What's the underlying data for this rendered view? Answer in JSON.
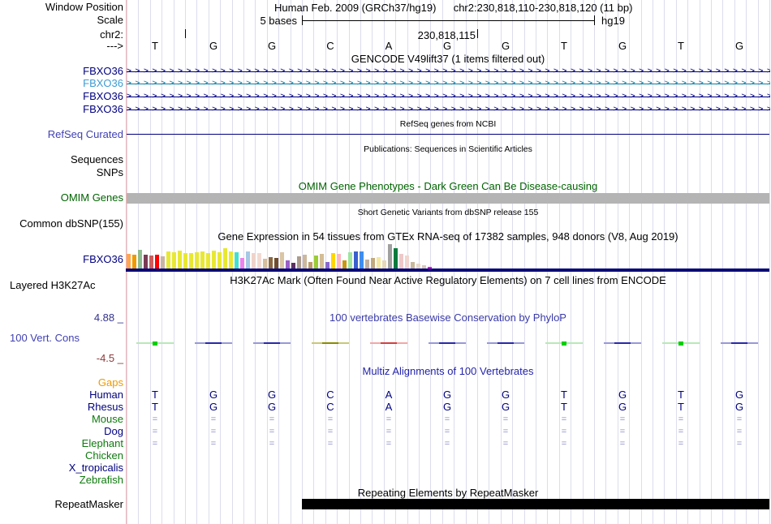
{
  "header": {
    "window_position_label": "Window Position",
    "assembly_title": "Human Feb. 2009 (GRCh37/hg19)",
    "range_title": "chr2:230,818,110-230,818,120 (11 bp)",
    "scale_label": "Scale",
    "scale_value": "5 bases",
    "assembly_tag": "hg19",
    "chrom_label": "chr2:",
    "coordinate_label": "230,818,115",
    "strand_label": "--->"
  },
  "sequence": {
    "bases": [
      "T",
      "G",
      "G",
      "C",
      "A",
      "G",
      "G",
      "T",
      "G",
      "T",
      "G"
    ]
  },
  "gencode": {
    "title": "GENCODE V49lift37 (1 items filtered out)",
    "genes": [
      {
        "label": "FBXO36",
        "label_color": "#000080",
        "line_color": "#000080"
      },
      {
        "label": "FBXO36",
        "label_color": "#3E9BD3",
        "line_color": "#0F7FA5"
      },
      {
        "label": "FBXO36",
        "label_color": "#000080",
        "line_color": "#000080"
      },
      {
        "label": "FBXO36",
        "label_color": "#000080",
        "line_color": "#000080"
      }
    ],
    "arrow_char": ">"
  },
  "refseq": {
    "title": "RefSeq genes from NCBI",
    "label": "RefSeq Curated",
    "label_color": "#4040B4",
    "line_color": "#000080"
  },
  "publications": {
    "title": "Publications: Sequences in Scientific Articles",
    "sequences_label": "Sequences",
    "snps_label": "SNPs"
  },
  "omim": {
    "title": "OMIM Gene Phenotypes - Dark Green Can Be Disease-causing",
    "label": "OMIM Genes",
    "color": "#006400",
    "bar_color": "#B4B4B4"
  },
  "dbsnp": {
    "title": "Short Genetic Variants from dbSNP release 155",
    "label": "Common dbSNP(155)"
  },
  "gtex": {
    "title": "Gene Expression in 54 tissues from GTEx RNA-seq of 17382 samples, 948 donors (V8, Aug 2019)",
    "label": "FBXO36",
    "label_color": "#000080",
    "baseline_color": "#0A0A78",
    "bars": [
      [
        "#FFA54F",
        18
      ],
      [
        "#EE9A00",
        17
      ],
      [
        "#8FBC8F",
        23
      ],
      [
        "#7A3A55",
        17
      ],
      [
        "#CD5C5C",
        16
      ],
      [
        "#FF0000",
        17
      ],
      [
        "#CBB3A3",
        15
      ],
      [
        "#E8E833",
        21
      ],
      [
        "#E8E833",
        20
      ],
      [
        "#E8E833",
        22
      ],
      [
        "#E8E833",
        19
      ],
      [
        "#E8E833",
        19
      ],
      [
        "#E8E833",
        20
      ],
      [
        "#E8E833",
        21
      ],
      [
        "#E8E833",
        19
      ],
      [
        "#E8E833",
        22
      ],
      [
        "#E8E833",
        20
      ],
      [
        "#E8E833",
        25
      ],
      [
        "#E8E833",
        21
      ],
      [
        "#40E0D0",
        20
      ],
      [
        "#EE82EE",
        13
      ],
      [
        "#A6C8E4",
        21
      ],
      [
        "#EFD3CA",
        19
      ],
      [
        "#F2DAD2",
        19
      ],
      [
        "#D6BE9C",
        12
      ],
      [
        "#8B6841",
        14
      ],
      [
        "#6E4C2D",
        13
      ],
      [
        "#DAC5A5",
        20
      ],
      [
        "#9A5FC8",
        10
      ],
      [
        "#5C3063",
        7
      ],
      [
        "#AB9C8E",
        15
      ],
      [
        "#CDB79B",
        17
      ],
      [
        "#BC9A68",
        8
      ],
      [
        "#9ACD32",
        16
      ],
      [
        "#D4BC96",
        18
      ],
      [
        "#8968CD",
        8
      ],
      [
        "#FFD700",
        19
      ],
      [
        "#FFB6C1",
        18
      ],
      [
        "#C79810",
        10
      ],
      [
        "#9FE49F",
        20
      ],
      [
        "#3A5FCD",
        21
      ],
      [
        "#3E8EF0",
        21
      ],
      [
        "#BFAF9F",
        11
      ],
      [
        "#C3A97E",
        13
      ],
      [
        "#F5E79E",
        14
      ],
      [
        "#E6D8B8",
        10
      ],
      [
        "#A0A0A0",
        30
      ],
      [
        "#0A7A3C",
        25
      ],
      [
        "#EFC8C8",
        18
      ],
      [
        "#F0D5D0",
        16
      ],
      [
        "#C9B89B",
        8
      ],
      [
        "#E8D8C8",
        6
      ],
      [
        "#D8C8B8",
        4
      ],
      [
        "#FF00E6",
        2
      ]
    ]
  },
  "h3k27ac": {
    "title": "H3K27Ac Mark (Often Found Near Active Regulatory Elements) on 7 cell lines from ENCODE",
    "label": "Layered H3K27Ac"
  },
  "phylop": {
    "title": "100 vertebrates Basewise Conservation by PhyloP",
    "title_color": "#3A3AA8",
    "label": "100 Vert. Cons",
    "label_color": "#4040B4",
    "max_label": "4.88 _",
    "max_color": "#34348C",
    "min_label": "-4.5 _",
    "min_color": "#8B3A3A",
    "segments": [
      "green",
      "blue",
      "blue",
      "olive",
      "red",
      "blue",
      "blue",
      "green",
      "blue",
      "green",
      "blue"
    ],
    "palette": {
      "green": {
        "line": "#B8E8B8",
        "core": "#00D000",
        "core_w": 6,
        "core_h": 5
      },
      "blue": {
        "line": "#9898D8",
        "core": "#2828A8",
        "core_w": 20,
        "core_h": 2
      },
      "olive": {
        "line": "#C8C878",
        "core": "#8B8B00",
        "core_w": 20,
        "core_h": 2
      },
      "red": {
        "line": "#F0A8A8",
        "core": "#D04040",
        "core_w": 20,
        "core_h": 2
      }
    }
  },
  "multiz": {
    "title": "Multiz Alignments of 100 Vertebrates",
    "title_color": "#2424AC",
    "dash_char": "=",
    "dash_color": "#8A8AC8",
    "letter_color": "#000080",
    "species": [
      {
        "name": "Gaps",
        "color": "#ED9A00",
        "row": "blank"
      },
      {
        "name": "Human",
        "color": "#000080",
        "row": "letters"
      },
      {
        "name": "Rhesus",
        "color": "#000080",
        "row": "letters"
      },
      {
        "name": "Mouse",
        "color": "#0E7A0E",
        "row": "dashes"
      },
      {
        "name": "Dog",
        "color": "#000080",
        "row": "dashes"
      },
      {
        "name": "Elephant",
        "color": "#0E7A0E",
        "row": "dashes"
      },
      {
        "name": "Chicken",
        "color": "#0E7A0E",
        "row": "blank"
      },
      {
        "name": "X_tropicalis",
        "color": "#000080",
        "row": "blank"
      },
      {
        "name": "Zebrafish",
        "color": "#0E7A0E",
        "row": "blank"
      }
    ]
  },
  "repeatmasker": {
    "title": "Repeating Elements by RepeatMasker",
    "label": "RepeatMasker",
    "bar_color": "#000000"
  }
}
